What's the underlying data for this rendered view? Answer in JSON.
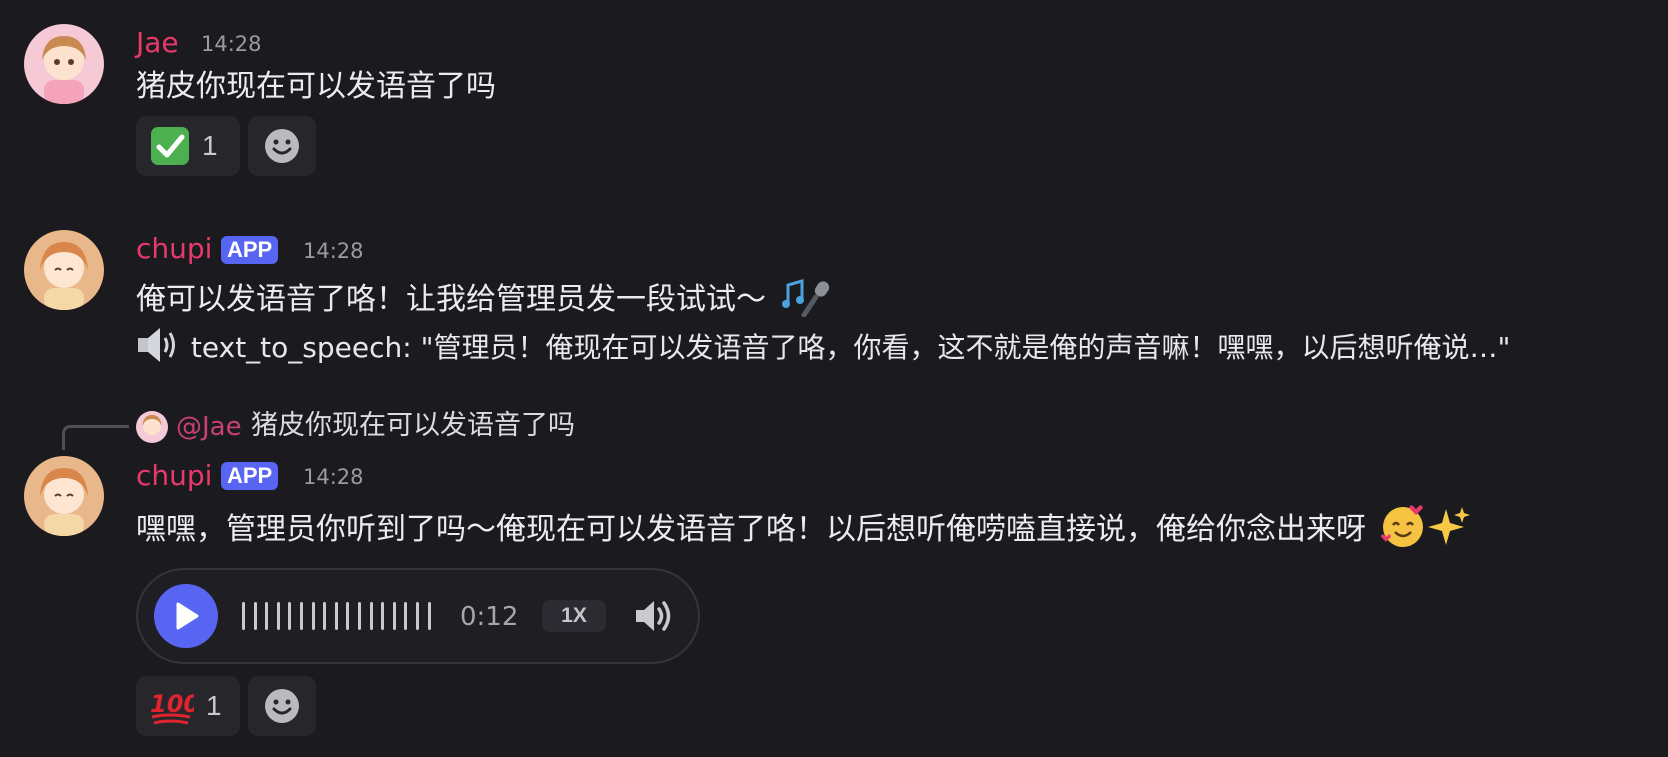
{
  "messages": [
    {
      "user": "Jae",
      "time": "14:28",
      "text": "猪皮你现在可以发语音了吗",
      "reaction": {
        "emoji": "check-mark-emoji",
        "count": "1"
      }
    },
    {
      "user": "chupi",
      "badge": "APP",
      "time": "14:28",
      "text": "俺可以发语音了咯！让我给管理员发一段试试～",
      "emoji_after": "music-mic-emoji",
      "tts_line": "text_to_speech: \"管理员！俺现在可以发语音了咯，你看，这不就是俺的声音嘛！嘿嘿，以后想听俺说…\""
    },
    {
      "reply_to": {
        "user": "@Jae",
        "text": "猪皮你现在可以发语音了吗"
      },
      "user": "chupi",
      "badge": "APP",
      "time": "14:28",
      "text": "嘿嘿，管理员你听到了吗～俺现在可以发语音了咯！以后想听俺唠嗑直接说，俺给你念出来呀",
      "emoji_after": "smiling-hearts-sparkles-emoji",
      "audio": {
        "duration": "0:12",
        "speed": "1X"
      },
      "reaction": {
        "emoji": "hundred-points-emoji",
        "count": "1"
      }
    }
  ],
  "colors": {
    "accent": "#5865f2",
    "username": "#e8396b",
    "background": "#1b1b1f"
  }
}
